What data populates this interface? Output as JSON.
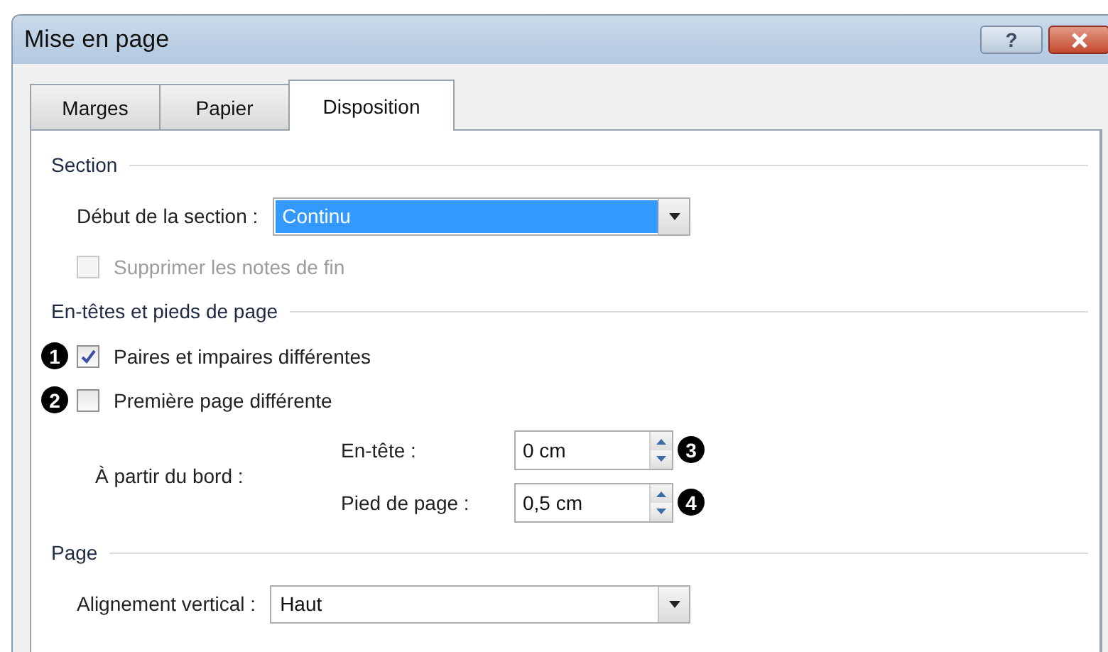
{
  "window": {
    "title": "Mise en page",
    "help_label": "?"
  },
  "tabs": [
    {
      "label": "Marges",
      "selected": false
    },
    {
      "label": "Papier",
      "selected": false
    },
    {
      "label": "Disposition",
      "selected": true
    }
  ],
  "sections": [
    {
      "title": "Section",
      "rows": [
        {
          "kind": "combo",
          "label": "Début de la section :",
          "value": "Continu",
          "highlighted": true
        },
        {
          "kind": "checkbox",
          "label": "Supprimer les notes de fin",
          "checked": false,
          "disabled": true
        }
      ]
    },
    {
      "title": "En-têtes et pieds de page",
      "rows": [
        {
          "kind": "checkbox",
          "label": "Paires et impaires différentes",
          "checked": true,
          "disabled": false,
          "callout": "1"
        },
        {
          "kind": "checkbox",
          "label": "Première page différente",
          "checked": false,
          "disabled": false,
          "callout": "2"
        },
        {
          "kind": "spin_group",
          "label": "À partir du bord :",
          "fields": [
            {
              "label": "En-tête :",
              "value": "0 cm",
              "callout": "3"
            },
            {
              "label": "Pied de page :",
              "value": "0,5 cm",
              "callout": "4"
            }
          ]
        }
      ]
    },
    {
      "title": "Page",
      "rows": [
        {
          "kind": "combo",
          "label": "Alignement vertical :",
          "value": "Haut",
          "highlighted": false
        }
      ]
    }
  ]
}
